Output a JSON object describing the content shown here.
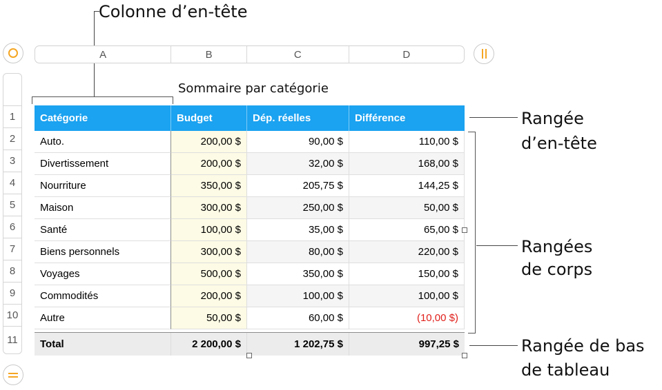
{
  "annotations": {
    "header_column": "Colonne d’en-tête",
    "header_row_line1": "Rangée",
    "header_row_line2": "d’en-tête",
    "body_rows_line1": "Rangées",
    "body_rows_line2": "de corps",
    "footer_row_line1": "Rangée de bas",
    "footer_row_line2": "de tableau"
  },
  "column_letters": [
    "A",
    "B",
    "C",
    "D"
  ],
  "row_numbers": [
    "1",
    "2",
    "3",
    "4",
    "5",
    "6",
    "7",
    "8",
    "9",
    "10",
    "11"
  ],
  "table": {
    "title": "Sommaire par catégorie",
    "headers": [
      "Catégorie",
      "Budget",
      "Dép. réelles",
      "Différence"
    ],
    "rows": [
      [
        "Auto.",
        "200,00 $",
        "90,00 $",
        "110,00 $"
      ],
      [
        "Divertissement",
        "200,00 $",
        "32,00 $",
        "168,00 $"
      ],
      [
        "Nourriture",
        "350,00 $",
        "205,75 $",
        "144,25 $"
      ],
      [
        "Maison",
        "300,00 $",
        "250,00 $",
        "50,00 $"
      ],
      [
        "Santé",
        "100,00 $",
        "35,00 $",
        "65,00 $"
      ],
      [
        "Biens personnels",
        "300,00 $",
        "80,00 $",
        "220,00 $"
      ],
      [
        "Voyages",
        "500,00 $",
        "350,00 $",
        "150,00 $"
      ],
      [
        "Commodités",
        "200,00 $",
        "100,00 $",
        "100,00 $"
      ],
      [
        "Autre",
        "50,00 $",
        "60,00 $",
        "(10,00 $)"
      ]
    ],
    "footer": [
      "Total",
      "2 200,00 $",
      "1 202,75 $",
      "997,25 $"
    ]
  },
  "colors": {
    "header_fill": "#1ba2f0",
    "budget_fill": "#fdfbe5",
    "negative_text": "#e0201b",
    "control_accent": "#f5a623"
  },
  "icons": [
    "select-table-icon",
    "column-handle-icon",
    "row-handle-icon"
  ]
}
